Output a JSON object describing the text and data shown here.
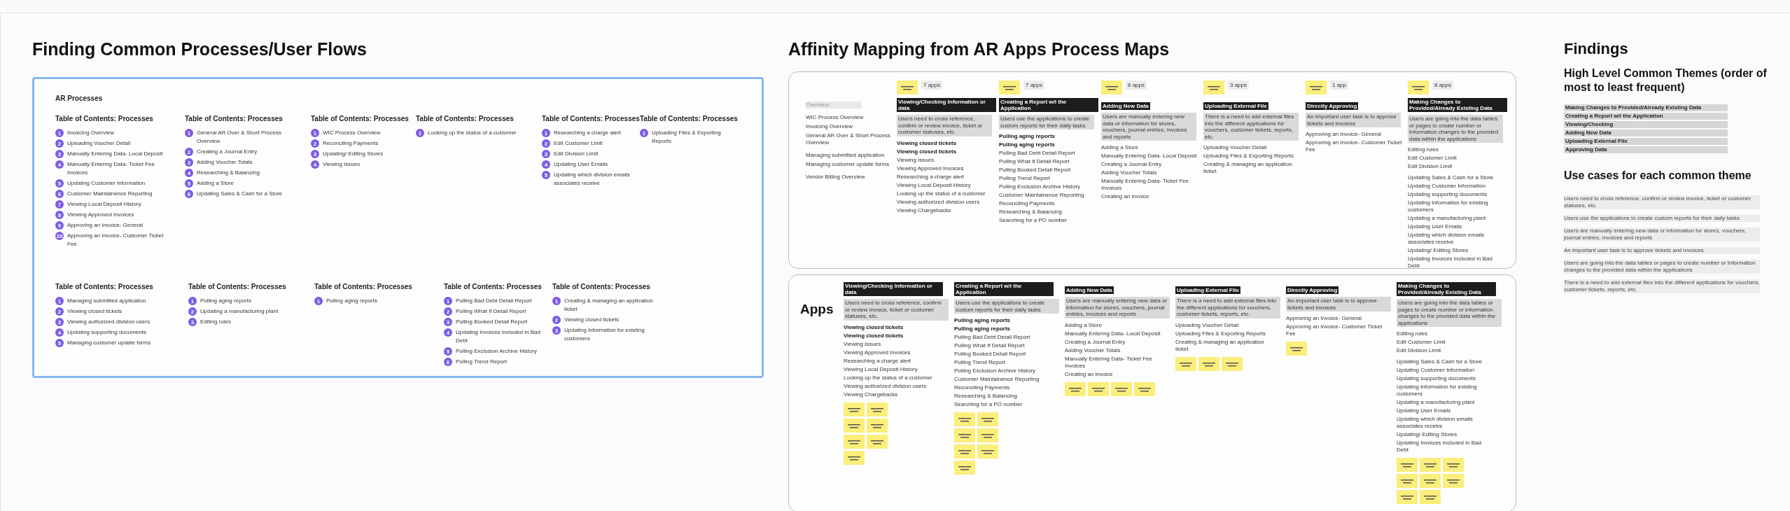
{
  "processes": {
    "title": "Finding Common Processes/User Flows",
    "frame_title": "AR Processes",
    "toc_rows": [
      [
        {
          "heading": "Table of Contents: Processes",
          "items": [
            {
              "number": "1",
              "label": "Invoicing Overview"
            },
            {
              "number": "2",
              "label": "Uploading Voucher Detail"
            },
            {
              "number": "3",
              "label": "Manually Entering Data- Local Deposit"
            },
            {
              "number": "4",
              "label": "Manually Entering Data- Ticket Fee Invoices"
            },
            {
              "number": "5",
              "label": "Updating Customer Information"
            },
            {
              "number": "6",
              "label": "Customer Maintainence Reporting"
            },
            {
              "number": "7",
              "label": "Viewing Local Deposit History"
            },
            {
              "number": "8",
              "label": "Viewing Approved Invoices"
            },
            {
              "number": "9",
              "label": "Approving an Invoice- General"
            },
            {
              "number": "10",
              "label": "Approving an Invoice- Customer Ticket Fee"
            }
          ]
        },
        {
          "heading": "Table of Contents: Processes",
          "items": [
            {
              "number": "1",
              "label": "General AR Over & Short Process Overview"
            },
            {
              "number": "2",
              "label": "Creating a Journal Entry"
            },
            {
              "number": "3",
              "label": "Adding Voucher Totals"
            },
            {
              "number": "4",
              "label": "Researching & Balancing"
            },
            {
              "number": "5",
              "label": "Adding a Store"
            },
            {
              "number": "6",
              "label": "Updating Sales & Cash for a Store"
            }
          ]
        },
        {
          "heading": "Table of Contents: Processes",
          "items": [
            {
              "number": "1",
              "label": "WIC Process Overview"
            },
            {
              "number": "2",
              "label": "Reconciling Payments"
            },
            {
              "number": "3",
              "label": "Updating/ Editing Stores"
            },
            {
              "number": "4",
              "label": "Viewing Issues"
            }
          ]
        },
        {
          "heading": "Table of Contents: Processes",
          "items": [
            {
              "number": "1",
              "label": "Looking up the status of a customer"
            }
          ]
        },
        {
          "heading": "Table of Contents: Processes",
          "items": [
            {
              "number": "1",
              "label": "Researching a charge alert"
            },
            {
              "number": "2",
              "label": "Edit Customer Limit"
            },
            {
              "number": "3",
              "label": "Edit Division Limit"
            },
            {
              "number": "4",
              "label": "Updating User Emails"
            },
            {
              "number": "5",
              "label": "Updating which division emails associates receive"
            }
          ]
        },
        {
          "heading": "Table of Contents: Processes",
          "items": [
            {
              "number": "1",
              "label": "Uploading Files & Exporting Reports"
            }
          ]
        }
      ],
      [
        {
          "heading": "Table of Contents: Processes",
          "items": [
            {
              "number": "1",
              "label": "Managing submitted application"
            },
            {
              "number": "2",
              "label": "Viewing closed tickets"
            },
            {
              "number": "3",
              "label": "Viewing authorized division users"
            },
            {
              "number": "4",
              "label": "Updating supporting documents"
            },
            {
              "number": "5",
              "label": "Managing customer update forms"
            }
          ]
        },
        {
          "heading": "Table of Contents: Processes",
          "items": [
            {
              "number": "1",
              "label": "Pulling aging reports"
            },
            {
              "number": "2",
              "label": "Updating a manufacturing plant"
            },
            {
              "number": "3",
              "label": "Editing rules"
            }
          ]
        },
        {
          "heading": "Table of Contents: Processes",
          "items": [
            {
              "number": "1",
              "label": "Pulling aging reports"
            }
          ]
        },
        {
          "heading": "Table of Contents: Processes",
          "items": [
            {
              "number": "1",
              "label": "Pulling Bad Debt Detail Report"
            },
            {
              "number": "2",
              "label": "Pulling What If Detail Report"
            },
            {
              "number": "3",
              "label": "Pulling Booked Detail Report"
            },
            {
              "number": "4",
              "label": "Updating Invoices Included in Bad Debt"
            },
            {
              "number": "5",
              "label": "Pulling Exclusion Archive History"
            },
            {
              "number": "6",
              "label": "Pulling Trend Report"
            }
          ]
        },
        {
          "heading": "Table of Contents: Processes",
          "items": [
            {
              "number": "1",
              "label": "Creating & managing an application ticket"
            },
            {
              "number": "2",
              "label": "Viewing closed tickets"
            },
            {
              "number": "3",
              "label": "Updating information for existing customers"
            }
          ]
        }
      ]
    ]
  },
  "affinity": {
    "title": "Affinity Mapping from AR Apps Process Maps",
    "overview": [
      [
        "Overview"
      ],
      [
        "WIC Process Overview",
        "Invoicing Overview",
        "General AR Over & Short Process Overview"
      ],
      [
        "Managing submitted application",
        "Managing customer update forms"
      ],
      [
        "Vendor Billing Overview"
      ]
    ],
    "groups": [
      {
        "count": "7 apps",
        "title": "Viewing/Checking Information or data",
        "description": "Users need to cross reference, confirm or review invoice, ticket or customer statuses, etc.",
        "item_groups": [
          [
            {
              "label": "Viewing closed tickets",
              "bold": true
            },
            {
              "label": "Viewing closed tickets",
              "bold": true
            },
            {
              "label": "Viewing Issues",
              "bold": false
            },
            {
              "label": "Viewing Approved Invoices",
              "bold": false
            },
            {
              "label": "Researching a charge alert",
              "bold": false
            },
            {
              "label": "Viewing Local Deposit History",
              "bold": false
            },
            {
              "label": "Looking up the status of a customer",
              "bold": false
            },
            {
              "label": "Viewing authorized division users",
              "bold": false
            },
            {
              "label": "Viewing Chargebacks",
              "bold": false
            }
          ]
        ]
      },
      {
        "count": "7 apps",
        "title": "Creating a Report w/i the Application",
        "description": "Users use the applications to create custom reports for their daily tasks",
        "item_groups": [
          [
            {
              "label": "Pulling aging reports",
              "bold": true
            },
            {
              "label": "Pulling aging reports",
              "bold": true
            },
            {
              "label": "Pulling Bad Debt Detail Report",
              "bold": false
            },
            {
              "label": "Pulling What If Detail Report",
              "bold": false
            },
            {
              "label": "Pulling Booked Detail Report",
              "bold": false
            },
            {
              "label": "Pulling Trend Report",
              "bold": false
            },
            {
              "label": "Pulling Exclusion Archive History",
              "bold": false
            },
            {
              "label": "Customer Maintainence Reporting",
              "bold": false
            },
            {
              "label": "Reconciling Payments",
              "bold": false
            },
            {
              "label": "Researching & Balancing",
              "bold": false
            },
            {
              "label": "Searching for a PO number",
              "bold": false
            }
          ]
        ]
      },
      {
        "count": "6 apps",
        "title": "Adding New Data",
        "description": "Users are manually entering new data or information for stores, vouchers, journal entries, invoices and reports",
        "item_groups": [
          [
            {
              "label": "Adding a Store",
              "bold": false
            },
            {
              "label": "Manually Entering Data- Local Deposit",
              "bold": false
            },
            {
              "label": "Creating a Journal Entry",
              "bold": false
            },
            {
              "label": "Adding Voucher Totals",
              "bold": false
            },
            {
              "label": "Manually Entering Data- Ticket Fee Invoices",
              "bold": false
            },
            {
              "label": "Creating an invoice",
              "bold": false
            }
          ]
        ]
      },
      {
        "count": "3 apps",
        "title": "Uploading External File",
        "description": "There is a need to add external files into the different applications for vouchers, customer tickets, reports, etc.",
        "item_groups": [
          [
            {
              "label": "Uploading Voucher Detail",
              "bold": false
            },
            {
              "label": "Uploading Files & Exporting Reports",
              "bold": false
            },
            {
              "label": "Creating & managing an application ticket",
              "bold": false
            }
          ]
        ]
      },
      {
        "count": "1 app",
        "title": "Directly Approving",
        "description": "An important user task is to approve tickets and invoices",
        "item_groups": [
          [
            {
              "label": "Approving an Invoice- General",
              "bold": false
            },
            {
              "label": "Approving an Invoice- Customer Ticket Fee",
              "bold": false
            }
          ]
        ]
      },
      {
        "count": "8 apps",
        "title": "Making Changes to Provided/Already Existing Data",
        "description": "Users are going into the data tables or pages to create number or information changes to the provided data within the applications",
        "item_groups": [
          [
            {
              "label": "Editing rules",
              "bold": false
            },
            {
              "label": "Edit Customer Limit",
              "bold": false
            },
            {
              "label": "Edit Division Limit",
              "bold": false
            }
          ],
          [
            {
              "label": "Updating Sales & Cash for a Store",
              "bold": false
            },
            {
              "label": "Updating Customer Information",
              "bold": false
            },
            {
              "label": "Updating supporting documents",
              "bold": false
            },
            {
              "label": "Updating information for existing customers",
              "bold": false
            },
            {
              "label": "Updating a manufacturing plant",
              "bold": false
            },
            {
              "label": "Updating User Emails",
              "bold": false
            },
            {
              "label": "Updating which division emails associates receive",
              "bold": false
            },
            {
              "label": "Updating/ Editing Stores",
              "bold": false
            },
            {
              "label": "Updating Invoices Included in Bad Debt",
              "bold": false
            }
          ]
        ]
      }
    ]
  },
  "apps": {
    "title": "Apps",
    "groups": [
      {
        "title": "Viewing/Checking Information or data",
        "description": "Users need to cross reference, confirm or review invoice, ticket or customer statuses, etc.",
        "notes": [
          {
            "kind": "note"
          },
          {
            "kind": "note"
          },
          {
            "kind": "note"
          },
          {
            "kind": "note"
          },
          {
            "kind": "note"
          },
          {
            "kind": "note"
          },
          {
            "kind": "note"
          }
        ],
        "item_groups": [
          [
            {
              "label": "Viewing closed tickets",
              "bold": true
            },
            {
              "label": "Viewing closed tickets",
              "bold": true
            },
            {
              "label": "Viewing Issues",
              "bold": false
            },
            {
              "label": "Viewing Approved Invoices",
              "bold": false
            },
            {
              "label": "Researching a charge alert",
              "bold": false
            },
            {
              "label": "Viewing Local Deposit History",
              "bold": false
            },
            {
              "label": "Looking up the status of a customer",
              "bold": false
            },
            {
              "label": "Viewing authorized division users",
              "bold": false
            },
            {
              "label": "Viewing Chargebacks",
              "bold": false
            }
          ]
        ]
      },
      {
        "title": "Creating a Report w/i the Application",
        "description": "Users use the applications to create custom reports for their daily tasks",
        "notes": [
          {
            "kind": "note"
          },
          {
            "kind": "note"
          },
          {
            "kind": "note"
          },
          {
            "kind": "note"
          },
          {
            "kind": "note"
          },
          {
            "kind": "note"
          },
          {
            "kind": "note"
          }
        ],
        "item_groups": [
          [
            {
              "label": "Pulling aging reports",
              "bold": true
            },
            {
              "label": "Pulling aging reports",
              "bold": true
            },
            {
              "label": "Pulling Bad Debt Detail Report",
              "bold": false
            },
            {
              "label": "Pulling What If Detail Report",
              "bold": false
            },
            {
              "label": "Pulling Booked Detail Report",
              "bold": false
            },
            {
              "label": "Pulling Trend Report",
              "bold": false
            },
            {
              "label": "Pulling Exclusion Archive History",
              "bold": false
            },
            {
              "label": "Customer Maintainence Reporting",
              "bold": false
            },
            {
              "label": "Reconciling Payments",
              "bold": false
            },
            {
              "label": "Researching & Balancing",
              "bold": false
            },
            {
              "label": "Searching for a PO number",
              "bold": false
            }
          ]
        ]
      },
      {
        "title": "Adding New Data",
        "description": "Users are manually entering new data or information for stores, vouchers, journal entries, invoices and reports",
        "notes": [
          {
            "kind": "note"
          },
          {
            "kind": "note"
          },
          {
            "kind": "note"
          },
          {
            "kind": "note"
          }
        ],
        "item_groups": [
          [
            {
              "label": "Adding a Store",
              "bold": false
            },
            {
              "label": "Manually Entering Data- Local Deposit",
              "bold": false
            },
            {
              "label": "Creating a Journal Entry",
              "bold": false
            },
            {
              "label": "Adding Voucher Totals",
              "bold": false
            },
            {
              "label": "Manually Entering Data- Ticket Fee Invoices",
              "bold": false
            },
            {
              "label": "Creating an invoice",
              "bold": false
            }
          ]
        ]
      },
      {
        "title": "Uploading External File",
        "description": "There is a need to add external files into the different applications for vouchers, customer tickets, reports, etc.",
        "notes": [
          {
            "kind": "note"
          },
          {
            "kind": "note"
          },
          {
            "kind": "note"
          }
        ],
        "item_groups": [
          [
            {
              "label": "Uploading Voucher Detail",
              "bold": false
            },
            {
              "label": "Uploading Files & Exporting Reports",
              "bold": false
            },
            {
              "label": "Creating & managing an application ticket",
              "bold": false
            }
          ]
        ]
      },
      {
        "title": "Directly Approving",
        "description": "An important user task is to approve tickets and invoices",
        "notes": [
          {
            "kind": "note"
          }
        ],
        "item_groups": [
          [
            {
              "label": "Approving an Invoice- General",
              "bold": false
            },
            {
              "label": "Approving an Invoice- Customer Ticket Fee",
              "bold": false
            }
          ]
        ]
      },
      {
        "title": "Making Changes to Provided/Already Existing Data",
        "description": "Users are going into the data tables or pages to create number or information changes to the provided data within the applications",
        "notes": [
          {
            "kind": "note"
          },
          {
            "kind": "note"
          },
          {
            "kind": "note"
          },
          {
            "kind": "note"
          },
          {
            "kind": "note"
          },
          {
            "kind": "note"
          },
          {
            "kind": "note"
          },
          {
            "kind": "note"
          }
        ],
        "item_groups": [
          [
            {
              "label": "Editing rules",
              "bold": false
            },
            {
              "label": "Edit Customer Limit",
              "bold": false
            },
            {
              "label": "Edit Division Limit",
              "bold": false
            }
          ],
          [
            {
              "label": "Updating Sales & Cash for a Store",
              "bold": false
            },
            {
              "label": "Updating Customer Information",
              "bold": false
            },
            {
              "label": "Updating supporting documents",
              "bold": false
            },
            {
              "label": "Updating information for existing customers",
              "bold": false
            },
            {
              "label": "Updating a manufacturing plant",
              "bold": false
            },
            {
              "label": "Updating User Emails",
              "bold": false
            },
            {
              "label": "Updating which division emails associates receive",
              "bold": false
            },
            {
              "label": "Updating/ Editing Stores",
              "bold": false
            },
            {
              "label": "Updating Invoices Included in Bad Debt",
              "bold": false
            }
          ]
        ]
      }
    ]
  },
  "findings": {
    "title": "Findings",
    "themes_heading": "High Level Common Themes (order of most to least frequent)",
    "themes": [
      "Making Changes to Provided/Already Existing Data",
      "Creating a Report w/i the Application",
      "Viewing/Checking",
      "Adding New Data",
      "Uploading External File",
      "Approving Data"
    ],
    "use_cases_heading": "Use cases for each common theme",
    "use_cases": [
      "Users need to cross reference, confirm or review invoice, ticket or customer statuses, etc.",
      "Users use the applications to create custom reports for their daily tasks",
      "Users are manually entering new data or information for stores, vouchers, journal entries, invoices and reports",
      "An important user task is to approve tickets and invoices",
      "Users are going into the data tables or pages to create number or information changes to the provided data within the applications",
      "There is a need to add external files into the different applications for vouchers, customer tickets, reports, etc."
    ]
  }
}
